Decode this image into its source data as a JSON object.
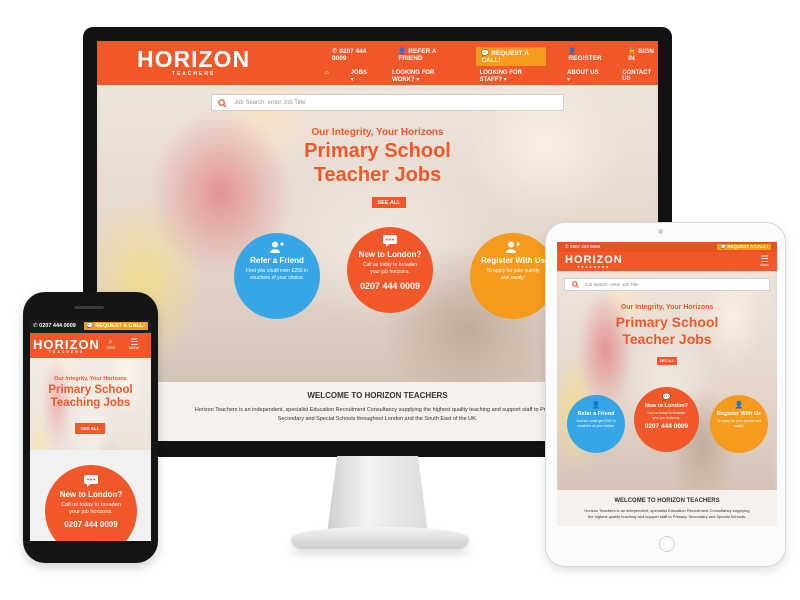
{
  "brand": {
    "logo": "HORIZON",
    "logo_sub": "TEACHERS",
    "accent": "#f0582a",
    "blue": "#36a6e6",
    "amber": "#f59a1c"
  },
  "desktop": {
    "top_links": {
      "phone": "0207 444 0009",
      "refer": "REFER A FRIEND",
      "callback": "REQUEST A CALL!",
      "register": "REGISTER",
      "signin": "SIGN IN"
    },
    "menu": [
      "JOBS ▾",
      "LOOKING FOR WORK? ▾",
      "LOOKING FOR STAFF? ▾",
      "ABOUT US ▾",
      "CONTACT US"
    ],
    "search_placeholder": "Job Search: enter Job Title",
    "tagline": "Our Integrity, Your Horizons",
    "title_line1": "Primary School",
    "title_line2": "Teacher Jobs",
    "see_all": "SEE ALL",
    "circles": [
      {
        "title": "Refer a Friend",
        "text": "Find you could earn £200 in vouchers of your choice.",
        "icon": "user-plus-icon"
      },
      {
        "title": "New to London?",
        "text": "Call us today to broaden your job horizons.",
        "phone": "0207 444 0009",
        "icon": "chat-icon"
      },
      {
        "title": "Register With Us",
        "text": "To apply for jobs quickly and easily!",
        "icon": "user-plus-icon"
      }
    ],
    "welcome_title": "WELCOME TO HORIZON TEACHERS",
    "welcome_text": "Horizon Teachers is an independent, specialist Education Recruitment Consultancy supplying the highest quality teaching and support staff to Primary, Secondary and Special Schools throughout London and the South East of the UK."
  },
  "tablet": {
    "phone": "0207 444 0009",
    "callback": "REQUEST A CALL!",
    "menu_label": "MENU",
    "search_placeholder": "Job Search: enter Job Title",
    "tagline": "Our Integrity, Your Horizons",
    "title_line1": "Primary School",
    "title_line2": "Teacher Jobs",
    "see_all": "SEE ALL",
    "circles": [
      {
        "title": "Refer a Friend",
        "text": "And we could get £200 in vouchers of your choice."
      },
      {
        "title": "New to London?",
        "text": "Call us today to broaden your job horizons.",
        "phone": "0207 444 0009"
      },
      {
        "title": "Register With Us",
        "text": "To apply for jobs quickly and easily!"
      }
    ],
    "welcome_title": "WELCOME TO HORIZON TEACHERS",
    "welcome_text": "Horizon Teachers is an independent, specialist Education Recruitment Consultancy supplying the highest quality teaching and support staff to Primary, Secondary and Special Schools."
  },
  "phone": {
    "phone": "0207 444 0009",
    "callback": "REQUEST A CALL!",
    "jobs_label": "JOBS",
    "menu_label": "MENU",
    "tagline": "Our Integrity, Your Horizons",
    "title_line1": "Primary School",
    "title_line2": "Teaching Jobs",
    "see_all": "SEE ALL",
    "circle": {
      "title": "New to London?",
      "text": "Call us today to broaden your job horizons.",
      "phone": "0207 444 0009"
    }
  }
}
